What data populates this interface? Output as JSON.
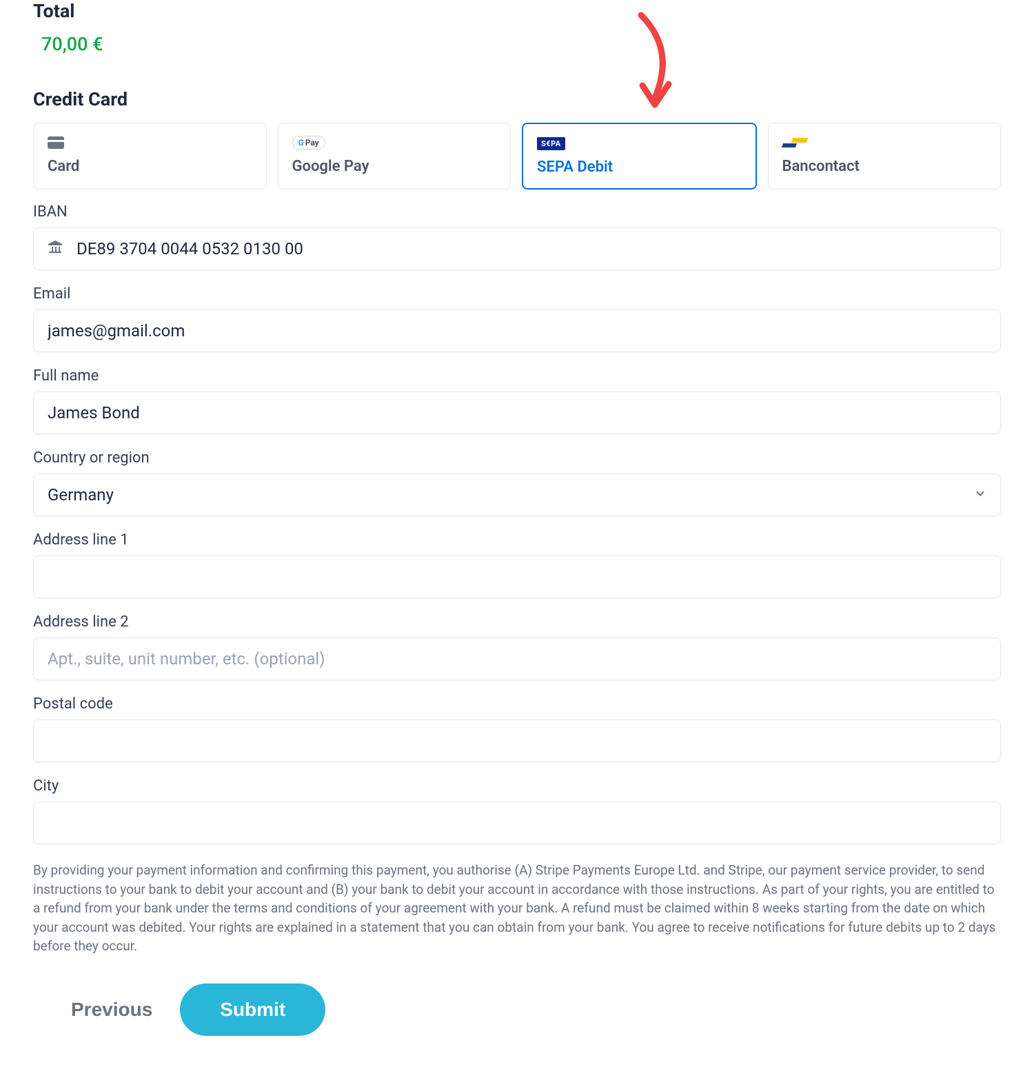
{
  "total": {
    "label": "Total",
    "amount": "70,00 €"
  },
  "section_title": "Credit Card",
  "payment_methods": [
    {
      "id": "card",
      "label": "Card",
      "selected": false
    },
    {
      "id": "google_pay",
      "label": "Google Pay",
      "selected": false
    },
    {
      "id": "sepa_debit",
      "label": "SEPA Debit",
      "selected": true
    },
    {
      "id": "bancontact",
      "label": "Bancontact",
      "selected": false
    }
  ],
  "gpay_badge_text": "Pay",
  "sepa_badge_text": "S€PA",
  "fields": {
    "iban": {
      "label": "IBAN",
      "value": "DE89 3704 0044 0532 0130 00",
      "placeholder": ""
    },
    "email": {
      "label": "Email",
      "value": "james@gmail.com",
      "placeholder": ""
    },
    "full_name": {
      "label": "Full name",
      "value": "James Bond",
      "placeholder": ""
    },
    "country": {
      "label": "Country or region",
      "value": "Germany"
    },
    "address1": {
      "label": "Address line 1",
      "value": "",
      "placeholder": ""
    },
    "address2": {
      "label": "Address line 2",
      "value": "",
      "placeholder": "Apt., suite, unit number, etc. (optional)"
    },
    "postal": {
      "label": "Postal code",
      "value": "",
      "placeholder": ""
    },
    "city": {
      "label": "City",
      "value": "",
      "placeholder": ""
    }
  },
  "disclaimer": "By providing your payment information and confirming this payment, you authorise (A) Stripe Payments Europe Ltd. and Stripe, our payment service provider, to send instructions to your bank to debit your account and (B) your bank to debit your account in accordance with those instructions. As part of your rights, you are entitled to a refund from your bank under the terms and conditions of your agreement with your bank. A refund must be claimed within 8 weeks starting from the date on which your account was debited. Your rights are explained in a statement that you can obtain from your bank. You agree to receive notifications for future debits up to 2 days before they occur.",
  "buttons": {
    "previous": "Previous",
    "submit": "Submit"
  },
  "colors": {
    "accent_blue": "#0570de",
    "success_green": "#16a34a",
    "submit_teal": "#29b6d8",
    "arrow_red": "#ef4444"
  }
}
